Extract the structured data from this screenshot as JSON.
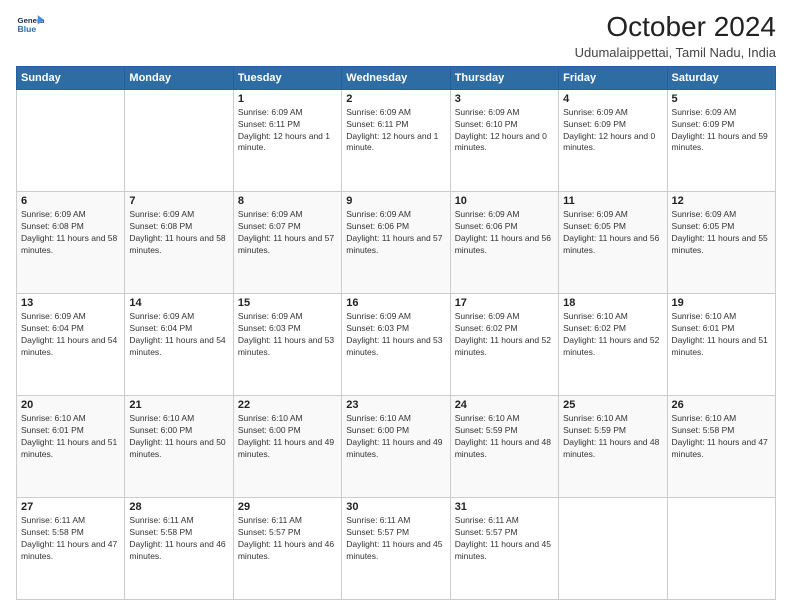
{
  "logo": {
    "line1": "General",
    "line2": "Blue"
  },
  "title": "October 2024",
  "subtitle": "Udumalaippettai, Tamil Nadu, India",
  "weekdays": [
    "Sunday",
    "Monday",
    "Tuesday",
    "Wednesday",
    "Thursday",
    "Friday",
    "Saturday"
  ],
  "weeks": [
    [
      {
        "day": "",
        "info": ""
      },
      {
        "day": "",
        "info": ""
      },
      {
        "day": "1",
        "info": "Sunrise: 6:09 AM\nSunset: 6:11 PM\nDaylight: 12 hours and 1 minute."
      },
      {
        "day": "2",
        "info": "Sunrise: 6:09 AM\nSunset: 6:11 PM\nDaylight: 12 hours and 1 minute."
      },
      {
        "day": "3",
        "info": "Sunrise: 6:09 AM\nSunset: 6:10 PM\nDaylight: 12 hours and 0 minutes."
      },
      {
        "day": "4",
        "info": "Sunrise: 6:09 AM\nSunset: 6:09 PM\nDaylight: 12 hours and 0 minutes."
      },
      {
        "day": "5",
        "info": "Sunrise: 6:09 AM\nSunset: 6:09 PM\nDaylight: 11 hours and 59 minutes."
      }
    ],
    [
      {
        "day": "6",
        "info": "Sunrise: 6:09 AM\nSunset: 6:08 PM\nDaylight: 11 hours and 58 minutes."
      },
      {
        "day": "7",
        "info": "Sunrise: 6:09 AM\nSunset: 6:08 PM\nDaylight: 11 hours and 58 minutes."
      },
      {
        "day": "8",
        "info": "Sunrise: 6:09 AM\nSunset: 6:07 PM\nDaylight: 11 hours and 57 minutes."
      },
      {
        "day": "9",
        "info": "Sunrise: 6:09 AM\nSunset: 6:06 PM\nDaylight: 11 hours and 57 minutes."
      },
      {
        "day": "10",
        "info": "Sunrise: 6:09 AM\nSunset: 6:06 PM\nDaylight: 11 hours and 56 minutes."
      },
      {
        "day": "11",
        "info": "Sunrise: 6:09 AM\nSunset: 6:05 PM\nDaylight: 11 hours and 56 minutes."
      },
      {
        "day": "12",
        "info": "Sunrise: 6:09 AM\nSunset: 6:05 PM\nDaylight: 11 hours and 55 minutes."
      }
    ],
    [
      {
        "day": "13",
        "info": "Sunrise: 6:09 AM\nSunset: 6:04 PM\nDaylight: 11 hours and 54 minutes."
      },
      {
        "day": "14",
        "info": "Sunrise: 6:09 AM\nSunset: 6:04 PM\nDaylight: 11 hours and 54 minutes."
      },
      {
        "day": "15",
        "info": "Sunrise: 6:09 AM\nSunset: 6:03 PM\nDaylight: 11 hours and 53 minutes."
      },
      {
        "day": "16",
        "info": "Sunrise: 6:09 AM\nSunset: 6:03 PM\nDaylight: 11 hours and 53 minutes."
      },
      {
        "day": "17",
        "info": "Sunrise: 6:09 AM\nSunset: 6:02 PM\nDaylight: 11 hours and 52 minutes."
      },
      {
        "day": "18",
        "info": "Sunrise: 6:10 AM\nSunset: 6:02 PM\nDaylight: 11 hours and 52 minutes."
      },
      {
        "day": "19",
        "info": "Sunrise: 6:10 AM\nSunset: 6:01 PM\nDaylight: 11 hours and 51 minutes."
      }
    ],
    [
      {
        "day": "20",
        "info": "Sunrise: 6:10 AM\nSunset: 6:01 PM\nDaylight: 11 hours and 51 minutes."
      },
      {
        "day": "21",
        "info": "Sunrise: 6:10 AM\nSunset: 6:00 PM\nDaylight: 11 hours and 50 minutes."
      },
      {
        "day": "22",
        "info": "Sunrise: 6:10 AM\nSunset: 6:00 PM\nDaylight: 11 hours and 49 minutes."
      },
      {
        "day": "23",
        "info": "Sunrise: 6:10 AM\nSunset: 6:00 PM\nDaylight: 11 hours and 49 minutes."
      },
      {
        "day": "24",
        "info": "Sunrise: 6:10 AM\nSunset: 5:59 PM\nDaylight: 11 hours and 48 minutes."
      },
      {
        "day": "25",
        "info": "Sunrise: 6:10 AM\nSunset: 5:59 PM\nDaylight: 11 hours and 48 minutes."
      },
      {
        "day": "26",
        "info": "Sunrise: 6:10 AM\nSunset: 5:58 PM\nDaylight: 11 hours and 47 minutes."
      }
    ],
    [
      {
        "day": "27",
        "info": "Sunrise: 6:11 AM\nSunset: 5:58 PM\nDaylight: 11 hours and 47 minutes."
      },
      {
        "day": "28",
        "info": "Sunrise: 6:11 AM\nSunset: 5:58 PM\nDaylight: 11 hours and 46 minutes."
      },
      {
        "day": "29",
        "info": "Sunrise: 6:11 AM\nSunset: 5:57 PM\nDaylight: 11 hours and 46 minutes."
      },
      {
        "day": "30",
        "info": "Sunrise: 6:11 AM\nSunset: 5:57 PM\nDaylight: 11 hours and 45 minutes."
      },
      {
        "day": "31",
        "info": "Sunrise: 6:11 AM\nSunset: 5:57 PM\nDaylight: 11 hours and 45 minutes."
      },
      {
        "day": "",
        "info": ""
      },
      {
        "day": "",
        "info": ""
      }
    ]
  ]
}
